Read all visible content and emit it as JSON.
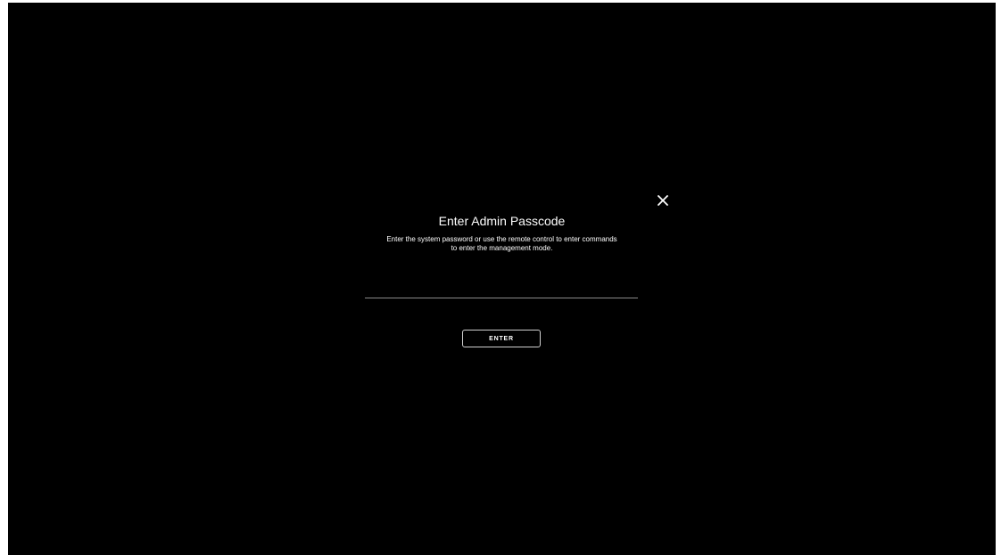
{
  "dialog": {
    "title": "Enter Admin Passcode",
    "description": "Enter the system password or use the remote control to enter commands to enter the management mode.",
    "passcode_value": "",
    "enter_label": "ENTER",
    "close_icon": "close-icon"
  },
  "colors": {
    "background": "#000000",
    "text": "#ffffff",
    "input_underline": "#8a8a8a",
    "button_border": "#d0d0d0"
  }
}
